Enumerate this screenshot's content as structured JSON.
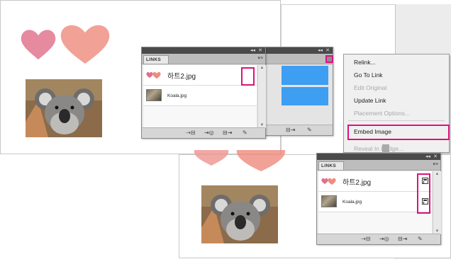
{
  "panel": {
    "tab_label": "LINKS",
    "collapse_glyph": "◂◂",
    "close_glyph": "✕",
    "menu_glyph": "▾≡"
  },
  "links": [
    {
      "name": "하트2.jpg",
      "thumb": "hearts"
    },
    {
      "name": "Koala.jpg",
      "thumb": "koala"
    }
  ],
  "bottom_icons": {
    "relink": "⇢⊟",
    "goto": "⇥◎",
    "update": "⊟⇥",
    "edit": "✎"
  },
  "context_menu": {
    "items": [
      {
        "label": "Relink...",
        "enabled": true
      },
      {
        "label": "Go To Link",
        "enabled": true
      },
      {
        "label": "Edit Original",
        "enabled": false
      },
      {
        "label": "Update Link",
        "enabled": true
      },
      {
        "label": "Placement Options...",
        "enabled": false
      },
      {
        "label": "Embed Image",
        "enabled": true,
        "highlighted": true
      },
      {
        "label": "Reveal In Bridge...",
        "enabled": false
      }
    ]
  },
  "colors": {
    "highlight": "#d8137f",
    "selection_blue": "#3d9ef2",
    "heart_pink": "#e0708b",
    "heart_peach": "#ef8c7f"
  },
  "icons": {
    "arrow": "down-arrow-icon",
    "embedded": "embedded-icon",
    "heart": "heart-icon",
    "koala": "koala-photo"
  }
}
